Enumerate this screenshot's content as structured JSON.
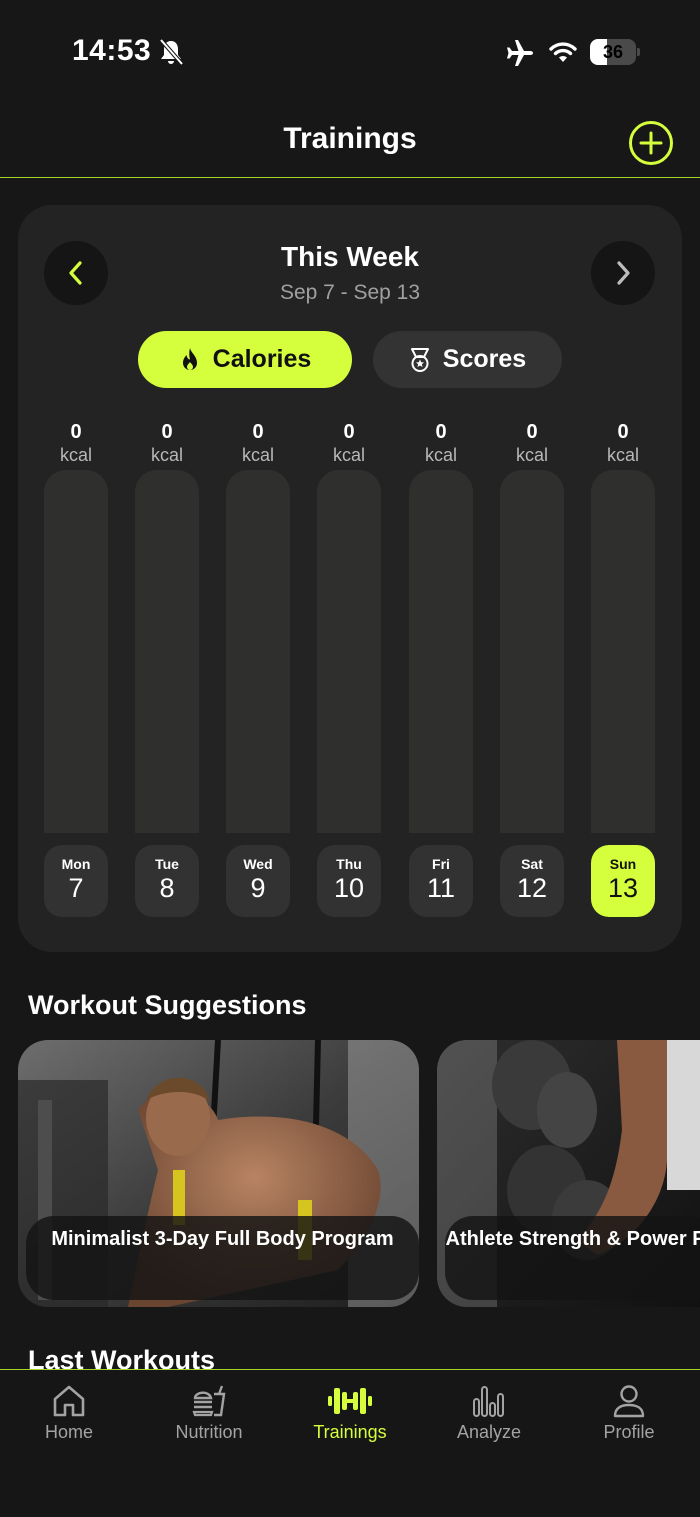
{
  "status_bar": {
    "time": "14:53",
    "battery": "36",
    "battery_level": 0.36
  },
  "header": {
    "title": "Trainings"
  },
  "week": {
    "title": "This Week",
    "range": "Sep 7 - Sep 13",
    "tabs": {
      "calories": "Calories",
      "scores": "Scores"
    },
    "days": [
      {
        "name": "Mon",
        "num": "7",
        "value": "0",
        "unit": "kcal"
      },
      {
        "name": "Tue",
        "num": "8",
        "value": "0",
        "unit": "kcal"
      },
      {
        "name": "Wed",
        "num": "9",
        "value": "0",
        "unit": "kcal"
      },
      {
        "name": "Thu",
        "num": "10",
        "value": "0",
        "unit": "kcal"
      },
      {
        "name": "Fri",
        "num": "11",
        "value": "0",
        "unit": "kcal"
      },
      {
        "name": "Sat",
        "num": "12",
        "value": "0",
        "unit": "kcal"
      },
      {
        "name": "Sun",
        "num": "13",
        "value": "0",
        "unit": "kcal"
      }
    ],
    "selected_day": "Sun"
  },
  "suggestions": {
    "title": "Workout Suggestions",
    "cards": [
      {
        "label": "Minimalist 3-Day Full Body Program"
      },
      {
        "label": "Athlete Strength & Power Program"
      }
    ]
  },
  "last_workouts": {
    "title": "Last Workouts"
  },
  "bottom_nav": {
    "items": [
      {
        "label": "Home"
      },
      {
        "label": "Nutrition"
      },
      {
        "label": "Trainings"
      },
      {
        "label": "Analyze"
      },
      {
        "label": "Profile"
      }
    ],
    "active": "Trainings"
  },
  "colors": {
    "accent": "#d5ff3d",
    "background": "#171717",
    "card": "#232323",
    "divider": "#a6d62a"
  }
}
